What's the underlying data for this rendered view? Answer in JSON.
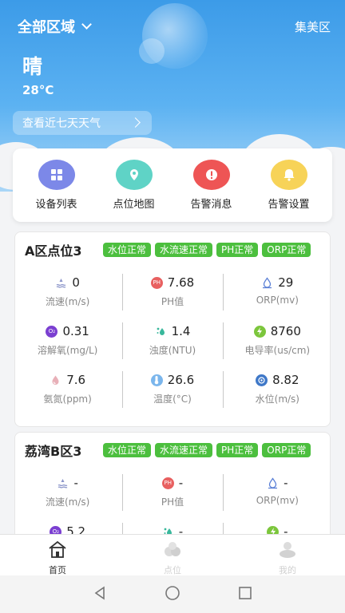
{
  "header": {
    "region": "全部区域",
    "district": "集美区",
    "weather": "晴",
    "temperature": "28°C",
    "week_forecast_button": "查看近七天天气"
  },
  "menu": [
    {
      "label": "设备列表",
      "icon": "grid-icon",
      "color": "#7c88e8"
    },
    {
      "label": "点位地图",
      "icon": "location-pin-icon",
      "color": "#5fd3c6"
    },
    {
      "label": "告警消息",
      "icon": "alert-icon",
      "color": "#ee5555"
    },
    {
      "label": "告警设置",
      "icon": "bell-icon",
      "color": "#f7d358"
    }
  ],
  "stations": [
    {
      "name": "A区点位3",
      "tags": [
        "水位正常",
        "水流速正常",
        "PH正常",
        "ORP正常"
      ],
      "metrics": [
        {
          "value": "0",
          "label": "流速(m/s)",
          "icon": "flow-icon"
        },
        {
          "value": "7.68",
          "label": "PH值",
          "icon": "ph-icon"
        },
        {
          "value": "29",
          "label": "ORP(mv)",
          "icon": "orp-icon"
        },
        {
          "value": "0.31",
          "label": "溶解氧(mg/L)",
          "icon": "oxygen-icon"
        },
        {
          "value": "1.4",
          "label": "浊度(NTU)",
          "icon": "turbidity-icon"
        },
        {
          "value": "8760",
          "label": "电导率(us/cm)",
          "icon": "conductivity-icon"
        },
        {
          "value": "7.6",
          "label": "氨氮(ppm)",
          "icon": "ammonia-icon"
        },
        {
          "value": "26.6",
          "label": "温度(°C)",
          "icon": "temperature-icon"
        },
        {
          "value": "8.82",
          "label": "水位(m/s)",
          "icon": "water-level-icon"
        }
      ]
    },
    {
      "name": "荔湾B区3",
      "tags": [
        "水位正常",
        "水流速正常",
        "PH正常",
        "ORP正常"
      ],
      "metrics": [
        {
          "value": "-",
          "label": "流速(m/s)",
          "icon": "flow-icon"
        },
        {
          "value": "-",
          "label": "PH值",
          "icon": "ph-icon"
        },
        {
          "value": "-",
          "label": "ORP(mv)",
          "icon": "orp-icon"
        },
        {
          "value": "5.2",
          "label": "",
          "icon": "oxygen-icon"
        },
        {
          "value": "-",
          "label": "",
          "icon": "turbidity-icon"
        },
        {
          "value": "-",
          "label": "",
          "icon": "conductivity-icon"
        }
      ]
    }
  ],
  "tabbar": [
    {
      "label": "首页",
      "icon": "home-icon",
      "active": true
    },
    {
      "label": "点位",
      "icon": "point-icon",
      "active": false
    },
    {
      "label": "我的",
      "icon": "profile-icon",
      "active": false
    }
  ],
  "colors": {
    "primary": "#3c9be8",
    "tag": "#4cbf3e",
    "active_tab": "#333333",
    "inactive_tab": "#d0d0d0"
  }
}
